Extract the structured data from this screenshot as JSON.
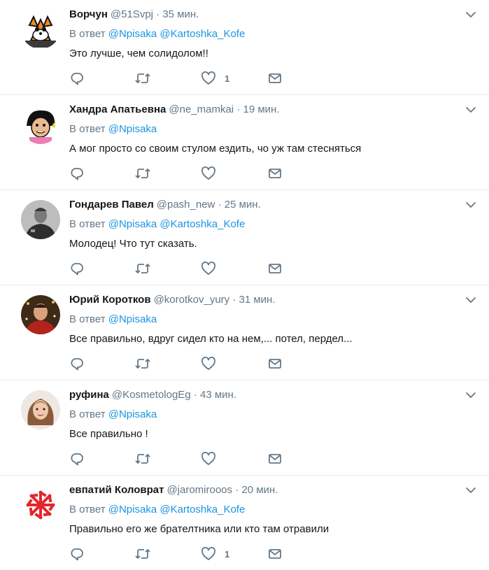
{
  "reply_label": "В ответ",
  "tweets": [
    {
      "name": "Ворчун",
      "handle": "@51Svpj",
      "time": "35 мин.",
      "mentions": [
        "@Npisaka",
        "@Kartoshka_Kofe"
      ],
      "text": "Это лучше, чем солидолом!!",
      "like_count": "1",
      "avatar_icon": "fox-cartoon-avatar-icon"
    },
    {
      "name": "Хандра Апатьевна",
      "handle": "@ne_mamkai",
      "time": "19 мин.",
      "mentions": [
        "@Npisaka"
      ],
      "text": "А мог просто со своим стулом  ездить, чо уж там стесняться",
      "like_count": "",
      "avatar_icon": "cartoon-woman-avatar-icon"
    },
    {
      "name": "Гондарев Павел",
      "handle": "@pash_new",
      "time": "25 мин.",
      "mentions": [
        "@Npisaka",
        "@Kartoshka_Kofe"
      ],
      "text": "Молодец! Что тут сказать.",
      "like_count": "",
      "avatar_icon": "bw-portrait-avatar-icon"
    },
    {
      "name": "Юрий Коротков",
      "handle": "@korotkov_yury",
      "time": "31 мин.",
      "mentions": [
        "@Npisaka"
      ],
      "text": "Все правильно, вдруг сидел кто на нем,... потел, пердел...",
      "like_count": "",
      "avatar_icon": "man-portrait-avatar-icon"
    },
    {
      "name": "руфина",
      "handle": "@KosmetologEg",
      "time": "43 мин.",
      "mentions": [
        "@Npisaka"
      ],
      "text": "Все правильно !",
      "like_count": "",
      "avatar_icon": "woman-portrait-avatar-icon"
    },
    {
      "name": "евпатий Коловрат",
      "handle": "@jaromirooos",
      "time": "20 мин.",
      "mentions": [
        "@Npisaka",
        "@Kartoshka_Kofe"
      ],
      "text": "Правильно его же брателтника  или кто там отравили",
      "like_count": "1",
      "avatar_icon": "red-kolovrat-symbol-avatar-icon"
    }
  ],
  "icons": {
    "reply": "reply-icon",
    "retweet": "retweet-icon",
    "like": "heart-icon",
    "dm": "envelope-icon",
    "caret": "chevron-down-icon"
  },
  "colors": {
    "text": "#14171a",
    "muted": "#657786",
    "link": "#1b95e0",
    "divider": "#e6ecf0"
  }
}
